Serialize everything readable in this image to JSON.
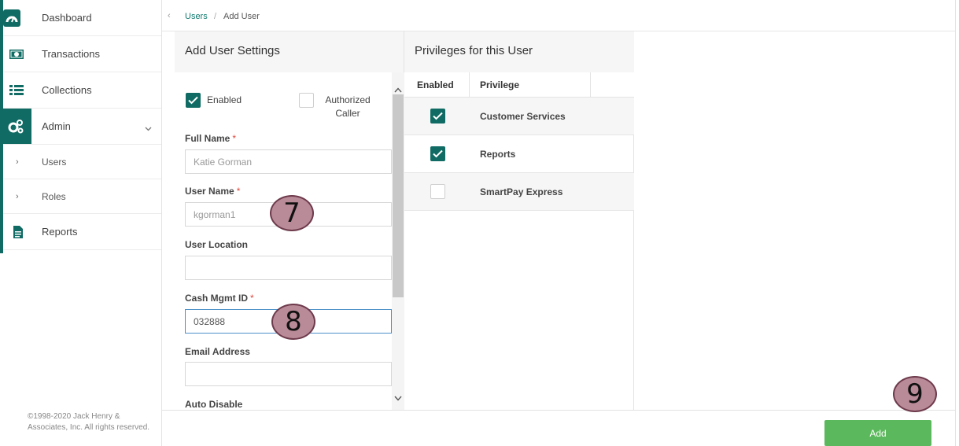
{
  "sidebar": {
    "items": [
      {
        "label": "Dashboard",
        "icon": "dashboard-icon"
      },
      {
        "label": "Transactions",
        "icon": "transactions-icon"
      },
      {
        "label": "Collections",
        "icon": "collections-icon"
      },
      {
        "label": "Admin",
        "icon": "admin-gears-icon"
      },
      {
        "label": "Users"
      },
      {
        "label": "Roles"
      },
      {
        "label": "Reports",
        "icon": "reports-icon"
      }
    ],
    "copyright": "©1998-2020 Jack Henry & Associates, Inc. All rights reserved."
  },
  "breadcrumb": {
    "back": "‹",
    "items": [
      "Users",
      "Add User"
    ],
    "separator": "/"
  },
  "settings": {
    "title": "Add User Settings",
    "enabled_label": "Enabled",
    "enabled_checked": true,
    "authorized_label": "Authorized Caller",
    "authorized_checked": false,
    "fields": [
      {
        "label": "Full Name",
        "required": true,
        "value": "Katie Gorman"
      },
      {
        "label": "User Name",
        "required": true,
        "value": "kgorman1"
      },
      {
        "label": "User Location",
        "required": false,
        "value": ""
      },
      {
        "label": "Cash Mgmt ID",
        "required": true,
        "value": "032888"
      },
      {
        "label": "Email Address",
        "required": false,
        "value": ""
      },
      {
        "label": "Auto Disable",
        "required": false
      }
    ],
    "required_mark": "*"
  },
  "privileges": {
    "title": "Privileges for this User",
    "columns": [
      "Enabled",
      "Privilege"
    ],
    "rows": [
      {
        "name": "Customer Services",
        "enabled": true
      },
      {
        "name": "Reports",
        "enabled": true
      },
      {
        "name": "SmartPay Express",
        "enabled": false
      }
    ]
  },
  "footer": {
    "add_label": "Add"
  },
  "steps": [
    "7",
    "8",
    "9"
  ],
  "colors": {
    "teal": "#0f6b63",
    "add_button": "#5cb85c",
    "required": "#e0463b",
    "step_marker": "#b98a97"
  }
}
